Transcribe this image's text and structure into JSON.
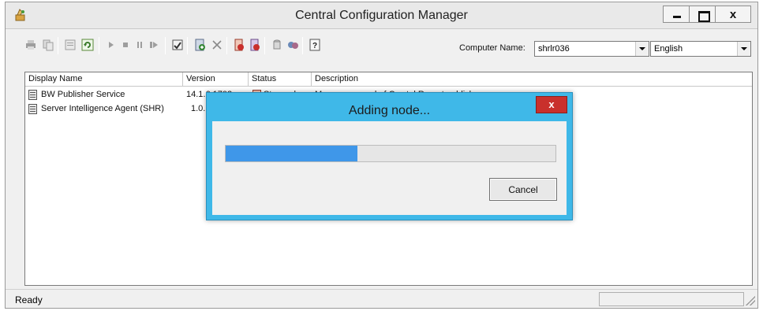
{
  "window": {
    "title": "Central Configuration Manager",
    "close_glyph": "x"
  },
  "toolbar": {
    "icons": [
      "print-icon",
      "copy-icon",
      "properties-icon",
      "refresh-icon",
      "start-icon",
      "stop-icon",
      "pause-icon",
      "resume-icon",
      "configure-icon",
      "add-node-icon",
      "delete-icon",
      "add-server-icon",
      "remove-server-icon",
      "database-icon",
      "manage-icon",
      "help-icon"
    ],
    "computer_name_label": "Computer Name:",
    "computer_name_value": "shrlr036",
    "language_value": "English"
  },
  "list": {
    "columns": [
      "Display Name",
      "Version",
      "Status",
      "Description"
    ],
    "rows": [
      {
        "name": "BW Publisher Service",
        "version": "14.1.6.1702",
        "status": "Stopped",
        "description": "Manages a pool of Crystal Report publishers"
      },
      {
        "name": "Server Intelligence Agent (SHR)",
        "version": "1.0.",
        "status": "",
        "description": ""
      }
    ]
  },
  "status_bar": {
    "text": "Ready"
  },
  "dialog": {
    "title": "Adding node...",
    "close_glyph": "x",
    "progress": 0.4,
    "cancel_label": "Cancel"
  },
  "colors": {
    "dialog_frame": "#3fb8e8",
    "progress_fill": "#3f97e9",
    "close_button": "#c9302c"
  }
}
